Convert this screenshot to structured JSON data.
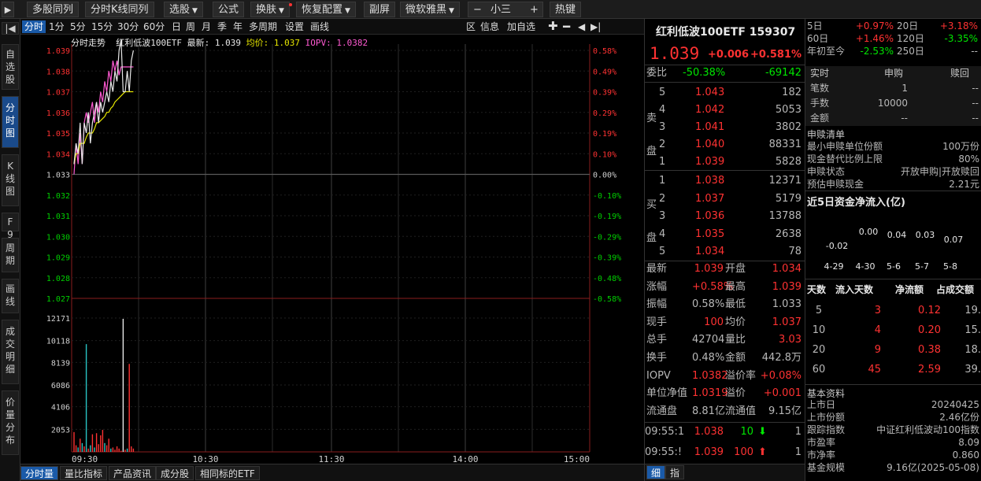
{
  "toolbar": {
    "items": [
      "多股同列",
      "分时K线同列",
      "选股",
      "公式",
      "换肤",
      "恢复配置",
      "副屏",
      "微软雅黑",
      "小三",
      "热键"
    ],
    "minus": "−",
    "plus": "+"
  },
  "left_nav": [
    "自选股",
    "分时图",
    "K线图",
    "F9",
    "周期",
    "画线",
    "成交明细",
    "价量分布"
  ],
  "periods": [
    "分时",
    "1分",
    "5分",
    "15分",
    "30分",
    "60分",
    "日",
    "周",
    "月",
    "季",
    "年",
    "多周期",
    "设置",
    "画线"
  ],
  "chart_tools": [
    "区",
    "信息",
    "加自选"
  ],
  "chart_header": {
    "label": "分时走势",
    "name": "红利低波100ETF",
    "latest_label": "最新:",
    "latest": "1.039",
    "avg_label": "均价:",
    "avg": "1.037",
    "iopv_label": "IOPV:",
    "iopv": "1.0382"
  },
  "chart_data": {
    "type": "line",
    "price_ticks": [
      "1.039",
      "1.038",
      "1.037",
      "1.036",
      "1.035",
      "1.034",
      "1.033",
      "1.032",
      "1.031",
      "1.030",
      "1.029",
      "1.028",
      "1.027"
    ],
    "pct_ticks": [
      "0.58%",
      "0.49%",
      "0.39%",
      "0.29%",
      "0.19%",
      "0.10%",
      "0.00%",
      "-0.10%",
      "-0.19%",
      "-0.29%",
      "-0.39%",
      "-0.48%",
      "-0.58%"
    ],
    "volume_ticks": [
      "12171",
      "10118",
      "8139",
      "6086",
      "4106",
      "2053"
    ],
    "time_ticks": [
      "09:30",
      "10:30",
      "11:30",
      "14:00",
      "15:00"
    ],
    "ylim": [
      1.027,
      1.039
    ],
    "prev_close": 1.033,
    "price": [
      1.0335,
      1.0345,
      1.034,
      1.0355,
      1.0335,
      1.0355,
      1.035,
      1.036,
      1.0345,
      1.0355,
      1.036,
      1.0365,
      1.0355,
      1.0365,
      1.036,
      1.0365,
      1.037,
      1.0365,
      1.0375,
      1.037,
      1.038,
      1.0375,
      1.039,
      1.0395,
      1.037,
      1.037,
      1.038,
      1.037,
      1.0385,
      1.039
    ],
    "avg": [
      1.0335,
      1.034,
      1.034,
      1.0345,
      1.0345,
      1.0345,
      1.0348,
      1.035,
      1.035,
      1.035,
      1.0352,
      1.0355,
      1.0355,
      1.0356,
      1.0357,
      1.0358,
      1.036,
      1.036,
      1.0362,
      1.0363,
      1.0365,
      1.0366,
      1.0367,
      1.0368,
      1.0369,
      1.037,
      1.037,
      1.037,
      1.037,
      1.037
    ],
    "iopv": [
      1.033,
      1.0345,
      1.0335,
      1.035,
      1.0335,
      1.0355,
      1.036,
      1.0355,
      1.036,
      1.0365,
      1.0355,
      1.0365,
      1.036,
      1.037,
      1.0365,
      1.0375,
      1.037,
      1.038,
      1.0375,
      1.0385,
      1.038,
      1.0385,
      1.0378,
      1.0382,
      1.0382,
      1.0382,
      1.0382,
      1.0382,
      1.0382,
      1.0382
    ],
    "volume": [
      1800,
      600,
      400,
      1200,
      800,
      500,
      9800,
      300,
      600,
      1600,
      400,
      1700,
      700,
      1500,
      2000,
      800,
      600,
      1200,
      300,
      400,
      200,
      500,
      300,
      100,
      12100,
      200,
      300,
      8000,
      500,
      300
    ],
    "volume_colors": [
      "r",
      "r",
      "g",
      "r",
      "g",
      "r",
      "g",
      "r",
      "g",
      "r",
      "g",
      "r",
      "r",
      "r",
      "r",
      "g",
      "r",
      "r",
      "g",
      "r",
      "r",
      "r",
      "r",
      "r",
      "w",
      "r",
      "g",
      "r",
      "r",
      "r"
    ]
  },
  "bottom_tabs": [
    "分时量",
    "量比指标",
    "产品资讯",
    "成分股",
    "相同标的ETF"
  ],
  "quote": {
    "name": "红利低波100ETF",
    "code": "159307",
    "price": "1.039",
    "change": "+0.006",
    "pct": "+0.581%",
    "webi_label": "委比",
    "webi": "-50.38%",
    "weicha": "-69142",
    "sell_label": [
      "卖",
      "盘"
    ],
    "buy_label": [
      "买",
      "盘"
    ],
    "asks": [
      {
        "lv": "5",
        "p": "1.043",
        "v": "182"
      },
      {
        "lv": "4",
        "p": "1.042",
        "v": "5053"
      },
      {
        "lv": "3",
        "p": "1.041",
        "v": "3802"
      },
      {
        "lv": "2",
        "p": "1.040",
        "v": "88331"
      },
      {
        "lv": "1",
        "p": "1.039",
        "v": "5828"
      }
    ],
    "bids": [
      {
        "lv": "1",
        "p": "1.038",
        "v": "12371"
      },
      {
        "lv": "2",
        "p": "1.037",
        "v": "5179"
      },
      {
        "lv": "3",
        "p": "1.036",
        "v": "13788"
      },
      {
        "lv": "4",
        "p": "1.035",
        "v": "2638"
      },
      {
        "lv": "5",
        "p": "1.034",
        "v": "78"
      }
    ],
    "stats": [
      {
        "k1": "最新",
        "v1": "1.039",
        "k2": "开盘",
        "v2": "1.034"
      },
      {
        "k1": "涨幅",
        "v1": "+0.58%",
        "k2": "最高",
        "v2": "1.039"
      },
      {
        "k1": "振幅",
        "v1": "0.58%",
        "k2": "最低",
        "v2": "1.033"
      },
      {
        "k1": "现手",
        "v1": "100",
        "k2": "均价",
        "v2": "1.037"
      },
      {
        "k1": "总手",
        "v1": "42704",
        "k2": "量比",
        "v2": "3.03"
      },
      {
        "k1": "换手",
        "v1": "0.48%",
        "k2": "金额",
        "v2": "442.8万"
      },
      {
        "k1": "IOPV",
        "v1": "1.0382",
        "k2": "溢价率",
        "v2": "+0.08%"
      },
      {
        "k1": "单位净值",
        "v1": "1.0319",
        "k2": "溢价",
        "v2": "+0.001"
      },
      {
        "k1": "流通盘",
        "v1": "8.81亿",
        "k2": "流通值",
        "v2": "9.15亿"
      }
    ],
    "ticks": [
      {
        "t": "09:55:1",
        "p": "1.038",
        "v": "10",
        "n": "1"
      },
      {
        "t": "09:55:!",
        "p": "1.039",
        "v": "100",
        "n": "1"
      }
    ],
    "tabs": [
      "细",
      "指"
    ]
  },
  "right": {
    "perf": [
      {
        "k": "5日",
        "v": "+0.97%",
        "k2": "20日",
        "v2": "+3.18%"
      },
      {
        "k": "60日",
        "v": "+1.46%",
        "k2": "120日",
        "v2": "-3.35%"
      },
      {
        "k": "年初至今",
        "v": "-2.53%",
        "k2": "250日",
        "v2": "--"
      }
    ],
    "sub_header": [
      "实时",
      "申购",
      "赎回"
    ],
    "sub_rows": [
      {
        "k": "笔数",
        "a": "1",
        "b": "--"
      },
      {
        "k": "手数",
        "a": "10000",
        "b": "--"
      },
      {
        "k": "金额",
        "a": "--",
        "b": "--"
      }
    ],
    "list_title": "申赎清单",
    "list": [
      {
        "k": "最小申赎单位份额",
        "v": "100万份"
      },
      {
        "k": "现金替代比例上限",
        "v": "80%"
      },
      {
        "k": "申赎状态",
        "v": "开放申购|开放赎回"
      },
      {
        "k": "预估申赎现金",
        "v": "2.21元"
      }
    ],
    "flow_title": "近5日资金净流入(亿)",
    "flow": {
      "vals": [
        "-0.02",
        "0.00",
        "0.04",
        "0.03",
        "0.07"
      ],
      "dates": [
        "4-29",
        "4-30",
        "5-6",
        "5-7",
        "5-8"
      ]
    },
    "flow_header": [
      "天数",
      "流入天数",
      "净流额",
      "占成交额"
    ],
    "flow_rows": [
      {
        "d": "5",
        "n": "3",
        "a": "0.12",
        "p": "19."
      },
      {
        "d": "10",
        "n": "4",
        "a": "0.20",
        "p": "15."
      },
      {
        "d": "20",
        "n": "9",
        "a": "0.38",
        "p": "18."
      },
      {
        "d": "60",
        "n": "45",
        "a": "2.59",
        "p": "39."
      }
    ],
    "basic_title": "基本资料",
    "basic": [
      {
        "k": "上市日",
        "v": "20240425"
      },
      {
        "k": "上市份额",
        "v": "2.46亿份"
      },
      {
        "k": "跟踪指数",
        "v": "中证红利低波动100指数"
      },
      {
        "k": "市盈率",
        "v": "8.09"
      },
      {
        "k": "市净率",
        "v": "0.860"
      },
      {
        "k": "基金规模",
        "v": "9.16亿(2025-05-08)"
      }
    ]
  }
}
